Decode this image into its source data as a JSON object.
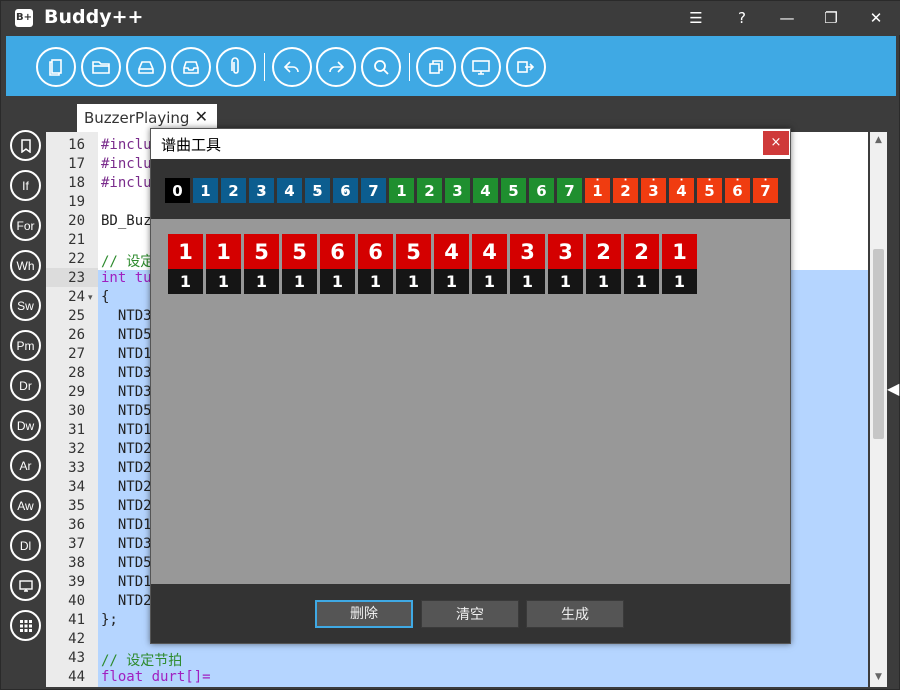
{
  "app": {
    "logo": "B+",
    "title": "Buddy++",
    "controls": {
      "menu": "☰",
      "help": "?",
      "minimize": "—",
      "restore": "❐",
      "close": "✕"
    }
  },
  "toolbar": {
    "buttons": [
      "new-file",
      "open-folder",
      "save",
      "inbox",
      "attach",
      "undo",
      "redo",
      "search",
      "copy",
      "monitor",
      "export"
    ]
  },
  "sidebar": {
    "buttons": [
      {
        "name": "bookmark",
        "label": ""
      },
      {
        "name": "if",
        "label": "If"
      },
      {
        "name": "for",
        "label": "For"
      },
      {
        "name": "wh",
        "label": "Wh"
      },
      {
        "name": "sw",
        "label": "Sw"
      },
      {
        "name": "pm",
        "label": "Pm"
      },
      {
        "name": "dr",
        "label": "Dr"
      },
      {
        "name": "dw",
        "label": "Dw"
      },
      {
        "name": "ar",
        "label": "Ar"
      },
      {
        "name": "aw",
        "label": "Aw"
      },
      {
        "name": "dl",
        "label": "Dl"
      },
      {
        "name": "monitor",
        "label": ""
      },
      {
        "name": "grid",
        "label": ""
      }
    ]
  },
  "tab": {
    "label": "BuzzerPlaying",
    "close": "✕"
  },
  "editor": {
    "current_line": 23,
    "lines": [
      {
        "no": "16",
        "text": "#inclu",
        "cls": "c-pp"
      },
      {
        "no": "17",
        "text": "#inclu",
        "cls": "c-pp"
      },
      {
        "no": "18",
        "text": "#inclu",
        "cls": "c-pp"
      },
      {
        "no": "19",
        "text": "",
        "cls": ""
      },
      {
        "no": "20",
        "text": "BD_Buz",
        "cls": ""
      },
      {
        "no": "21",
        "text": "",
        "cls": ""
      },
      {
        "no": "22",
        "text": "// 设定",
        "cls": "c-cm"
      },
      {
        "no": "23",
        "text": "int tu",
        "cls": "c-kw"
      },
      {
        "no": "24",
        "text": "{",
        "cls": ""
      },
      {
        "no": "25",
        "text": "  NTD3",
        "cls": ""
      },
      {
        "no": "26",
        "text": "  NTD5",
        "cls": ""
      },
      {
        "no": "27",
        "text": "  NTD1",
        "cls": ""
      },
      {
        "no": "28",
        "text": "  NTD3",
        "cls": ""
      },
      {
        "no": "29",
        "text": "  NTD3",
        "cls": ""
      },
      {
        "no": "30",
        "text": "  NTD5",
        "cls": ""
      },
      {
        "no": "31",
        "text": "  NTD1",
        "cls": ""
      },
      {
        "no": "32",
        "text": "  NTD2",
        "cls": ""
      },
      {
        "no": "33",
        "text": "  NTD2",
        "cls": ""
      },
      {
        "no": "34",
        "text": "  NTD2",
        "cls": ""
      },
      {
        "no": "35",
        "text": "  NTD2",
        "cls": ""
      },
      {
        "no": "36",
        "text": "  NTD1",
        "cls": ""
      },
      {
        "no": "37",
        "text": "  NTD3",
        "cls": ""
      },
      {
        "no": "38",
        "text": "  NTD5",
        "cls": ""
      },
      {
        "no": "39",
        "text": "  NTD1",
        "cls": ""
      },
      {
        "no": "40",
        "text": "  NTD2",
        "cls": ""
      },
      {
        "no": "41",
        "text": "};",
        "cls": ""
      },
      {
        "no": "42",
        "text": "",
        "cls": ""
      },
      {
        "no": "43",
        "text": "// 设定节拍",
        "cls": "c-cm"
      },
      {
        "no": "44",
        "text": "float durt[]=",
        "cls": "c-kw"
      }
    ]
  },
  "dialog": {
    "title": "谱曲工具",
    "close": "×",
    "palette": [
      {
        "digit": "0",
        "dot": "",
        "color": "#000000"
      },
      {
        "digit": "1",
        "dot": "low",
        "color": "#0c5d8f"
      },
      {
        "digit": "2",
        "dot": "low",
        "color": "#0c5d8f"
      },
      {
        "digit": "3",
        "dot": "low",
        "color": "#0c5d8f"
      },
      {
        "digit": "4",
        "dot": "low",
        "color": "#0c5d8f"
      },
      {
        "digit": "5",
        "dot": "low",
        "color": "#0c5d8f"
      },
      {
        "digit": "6",
        "dot": "low",
        "color": "#0c5d8f"
      },
      {
        "digit": "7",
        "dot": "low",
        "color": "#0c5d8f"
      },
      {
        "digit": "1",
        "dot": "",
        "color": "#1f8f2f"
      },
      {
        "digit": "2",
        "dot": "",
        "color": "#1f8f2f"
      },
      {
        "digit": "3",
        "dot": "",
        "color": "#1f8f2f"
      },
      {
        "digit": "4",
        "dot": "",
        "color": "#1f8f2f"
      },
      {
        "digit": "5",
        "dot": "",
        "color": "#1f8f2f"
      },
      {
        "digit": "6",
        "dot": "",
        "color": "#1f8f2f"
      },
      {
        "digit": "7",
        "dot": "",
        "color": "#1f8f2f"
      },
      {
        "digit": "1",
        "dot": "high",
        "color": "#f03c10"
      },
      {
        "digit": "2",
        "dot": "high",
        "color": "#f03c10"
      },
      {
        "digit": "3",
        "dot": "high",
        "color": "#f03c10"
      },
      {
        "digit": "4",
        "dot": "high",
        "color": "#f03c10"
      },
      {
        "digit": "5",
        "dot": "high",
        "color": "#f03c10"
      },
      {
        "digit": "6",
        "dot": "high",
        "color": "#f03c10"
      },
      {
        "digit": "7",
        "dot": "high",
        "color": "#f03c10"
      }
    ],
    "notes": [
      {
        "pitch": "1",
        "beat": "1"
      },
      {
        "pitch": "1",
        "beat": "1"
      },
      {
        "pitch": "5",
        "beat": "1"
      },
      {
        "pitch": "5",
        "beat": "1"
      },
      {
        "pitch": "6",
        "beat": "1"
      },
      {
        "pitch": "6",
        "beat": "1"
      },
      {
        "pitch": "5",
        "beat": "1"
      },
      {
        "pitch": "4",
        "beat": "1"
      },
      {
        "pitch": "4",
        "beat": "1"
      },
      {
        "pitch": "3",
        "beat": "1"
      },
      {
        "pitch": "3",
        "beat": "1"
      },
      {
        "pitch": "2",
        "beat": "1"
      },
      {
        "pitch": "2",
        "beat": "1"
      },
      {
        "pitch": "1",
        "beat": "1"
      }
    ],
    "buttons": {
      "delete": "删除",
      "clear": "清空",
      "generate": "生成"
    }
  }
}
